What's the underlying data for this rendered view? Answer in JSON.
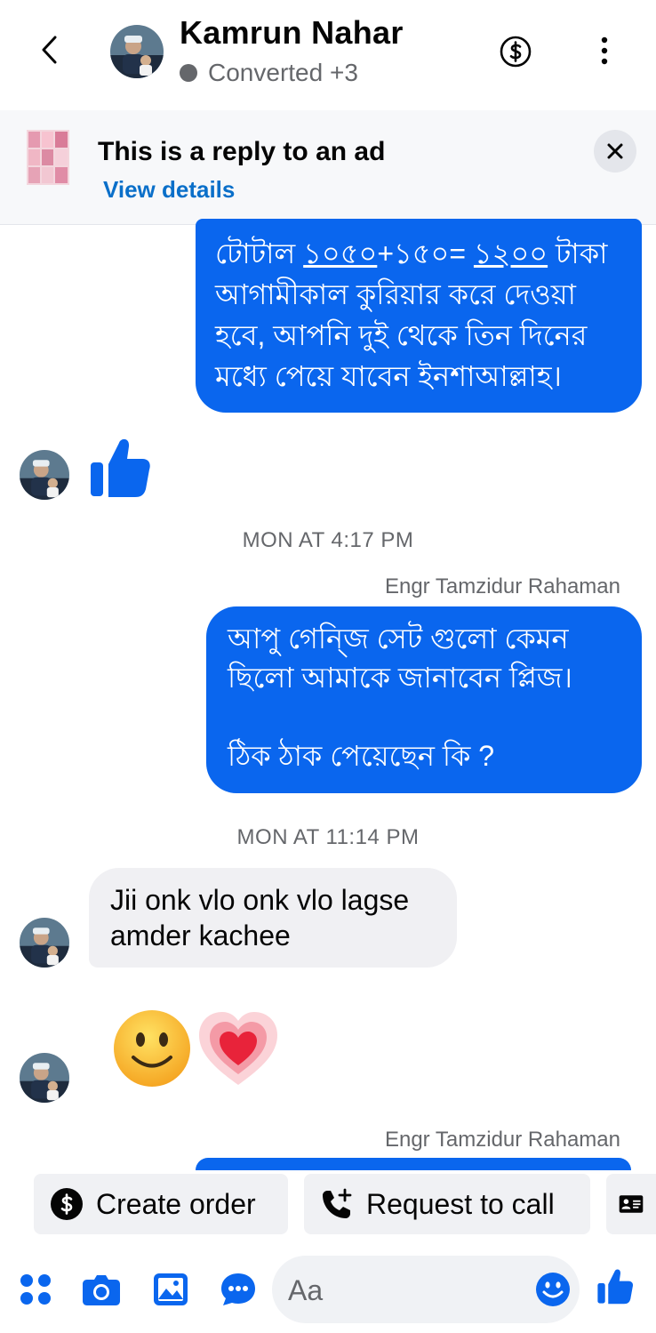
{
  "header": {
    "contact_name": "Kamrun Nahar",
    "status_text": "Converted +3",
    "back_icon": "chevron-left-icon",
    "dollar_icon": "dollar-circle-icon",
    "more_icon": "vertical-dots-icon"
  },
  "ad": {
    "title": "This is a reply to an ad",
    "link": "View details"
  },
  "messages": {
    "m1": {
      "line1_a": "টোটাল ",
      "line1_b": "১০৫০",
      "line1_c": "+১৫০= ",
      "line1_d": "১২০০",
      "line1_e": " টাকা",
      "line2": "আগামীকাল কুরিয়ার করে দেওয়া",
      "line3": "হবে, আপনি দুই থেকে তিন দিনের",
      "line4": "মধ্যে পেয়ে যাবেন ইনশাআল্লাহ।"
    },
    "ts1": "MON AT 4:17 PM",
    "sender1": "Engr Tamzidur Rahaman",
    "m2": {
      "line1": "আপু গেন্জি সেট গুলো কেমন",
      "line2": "ছিলো আমাকে জানাবেন প্লিজ।",
      "line3": "ঠিক ঠাক পেয়েছেন কি ?"
    },
    "ts2": "MON AT 11:14 PM",
    "m3": {
      "line1": "Jii onk vlo onk vlo lagse",
      "line2": "amder kachee"
    },
    "sender2": "Engr Tamzidur Rahaman"
  },
  "actions": {
    "create_order": "Create order",
    "request_call": "Request to call"
  },
  "composer": {
    "placeholder": "Aa"
  },
  "colors": {
    "accent": "#0a66ee",
    "link": "#0a6fc9",
    "muted": "#65676b",
    "bubble_in": "#f0f0f3"
  }
}
